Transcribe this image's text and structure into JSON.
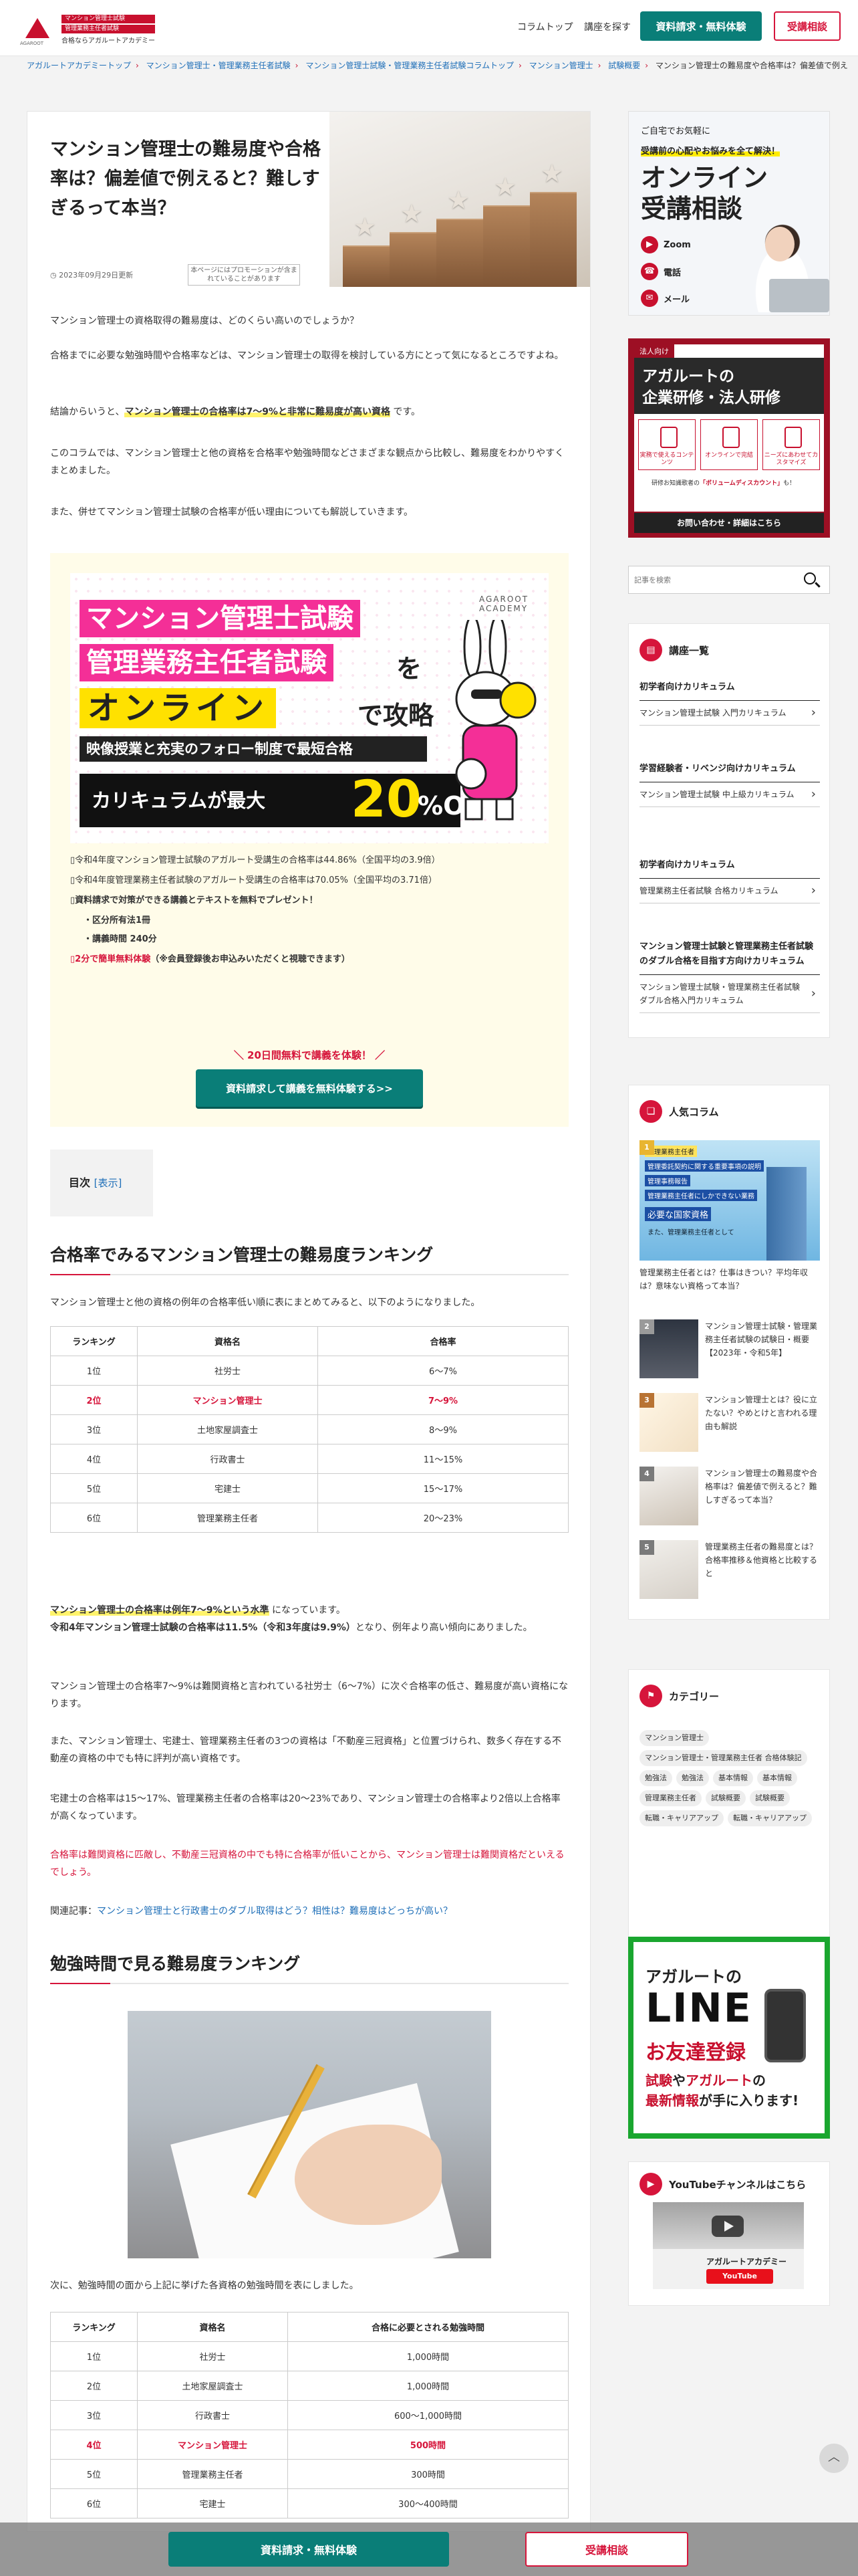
{
  "header": {
    "logo_mark": "AGAROOT",
    "logo_tag1": "マンション管理士試験",
    "logo_tag2": "管理業務主任者試験",
    "logo_sub": "合格ならアガルートアカデミー",
    "nav": [
      "コラムトップ",
      "講座を探す"
    ],
    "btn_request": "資料請求・無料体験",
    "btn_consult": "受講相談"
  },
  "breadcrumb": [
    "アガルートアカデミートップ",
    "マンション管理士・管理業務主任者試験",
    "マンション管理士試験・管理業務主任者試験コラムトップ",
    "マンション管理士",
    "試験概要",
    "マンション管理士の難易度や合格率は？偏差値で例える"
  ],
  "article": {
    "title": "マンション管理士の難易度や合格率は？偏差値で例えると？難しすぎるって本当？",
    "date": "2023年09月29日更新",
    "promo_note": "本ページにはプロモーションが含まれていることがあります",
    "p1": "マンション管理士の資格取得の難易度は、どのくらい高いのでしょうか？",
    "p2": "合格までに必要な勉強時間や合格率などは、マンション管理士の取得を検討している方にとって気になるところですよね。",
    "p3_pre": "結論からいうと、",
    "p3_hl": "マンション管理士の合格率は7〜9%と非常に難易度が高い資格",
    "p3_post": "です。",
    "p4": "このコラムでは、マンション管理士と他の資格を合格率や勉強時間などさまざまな観点から比較し、難易度をわかりやすくまとめました。",
    "p5": "また、併せてマンション管理士試験の合格率が低い理由についても解説していきます。",
    "toc_label": "目次",
    "toc_toggle": "[表示]",
    "h2_1": "合格率でみるマンション管理士の難易度ランキング",
    "p6": "マンション管理士と他の資格の例年の合格率低い順に表にまとめてみると、以下のようになりました。",
    "p7_hl": "マンション管理士の合格率は例年7〜9%という水準",
    "p7_post": "になっています。",
    "p7_b": "令和4年マンション管理士試験の合格率は11.5%（令和3年度は9.9%）",
    "p7_b_post": "となり、例年より高い傾向にありました。",
    "p8": "マンション管理士の合格率7〜9%は難関資格と言われている社労士（6〜7%）に次ぐ合格率の低さ、難易度が高い資格になります。",
    "p9": "また、マンション管理士、宅建士、管理業務主任者の3つの資格は「不動産三冠資格」と位置づけられ、数多く存在する不動産の資格の中でも特に評判が高い資格です。",
    "p10": "宅建士の合格率は15〜17%、管理業務主任者の合格率は20〜23%であり、マンション管理士の合格率より2倍以上合格率が高くなっています。",
    "p11": "合格率は難関資格に匹敵し、不動産三冠資格の中でも特に合格率が低いことから、マンション管理士は難関資格だといえるでしょう。",
    "related_pre": "関連記事：",
    "related_link": "マンション管理士と行政書士のダブル取得はどう？相性は？難易度はどっちが高い？",
    "h2_2": "勉強時間で見る難易度ランキング",
    "p12": "次に、勉強時間の面から上記に挙げた各資格の勉強時間を表にしました。"
  },
  "campaign": {
    "banner_logo": "AGAROOT ACADEMY",
    "banner_l1": "マンション管理士試験",
    "banner_l2": "管理業務主任者試験",
    "banner_l2w": "を",
    "banner_l3": "オンライン",
    "banner_l3w": "で攻略",
    "banner_l4": "映像授業と充実のフォロー制度で最短合格",
    "banner_l5": "カリキュラムが最大",
    "banner_l5n": "20",
    "banner_l5p": "%OFF",
    "li1": "▯令和4年度マンション管理士試験のアガルート受講生の合格率は44.86%（全国平均の3.9倍）",
    "li2": "▯令和4年度管理業務主任者試験のアガルート受講生の合格率は70.05%（全国平均の3.71倍）",
    "li3": "▯資料請求で対策ができる講義とテキストを無料でプレゼント！",
    "li3a": "・区分所有法1冊",
    "li3b": "・講義時間 240分",
    "li4_red": "▯2分で簡単無料体験",
    "li4_post": "（※会員登録後お申込みいただくと視聴できます）",
    "cta_text": "＼ 20日間無料で講義を体験！ ／",
    "cta_button": "資料請求して講義を無料体験する>>"
  },
  "table1": {
    "headers": [
      "ランキング",
      "資格名",
      "合格率"
    ],
    "rows": [
      [
        "1位",
        "社労士",
        "6〜7%"
      ],
      [
        "2位",
        "マンション管理士",
        "7〜9%"
      ],
      [
        "3位",
        "土地家屋調査士",
        "8〜9%"
      ],
      [
        "4位",
        "行政書士",
        "11〜15%"
      ],
      [
        "5位",
        "宅建士",
        "15〜17%"
      ],
      [
        "6位",
        "管理業務主任者",
        "20〜23%"
      ]
    ]
  },
  "table2": {
    "headers": [
      "ランキング",
      "資格名",
      "合格に必要とされる勉強時間"
    ],
    "rows": [
      [
        "1位",
        "社労士",
        "1,000時間"
      ],
      [
        "2位",
        "土地家屋調査士",
        "1,000時間"
      ],
      [
        "3位",
        "行政書士",
        "600〜1,000時間"
      ],
      [
        "4位",
        "マンション管理士",
        "500時間"
      ],
      [
        "5位",
        "管理業務主任者",
        "300時間"
      ],
      [
        "6位",
        "宅建士",
        "300〜400時間"
      ]
    ]
  },
  "sidebar": {
    "ad_online": {
      "t1": "ご自宅でお気軽に",
      "t2": "受講前の心配やお悩みを全て解決！",
      "t3a": "オンライン",
      "t3b": "受講相談",
      "i1": "Zoom",
      "i2": "電話",
      "i3": "メール"
    },
    "ad_corp": {
      "tag": "法人向け",
      "h1": "アガルートの",
      "h2": "企業研修・法人研修",
      "b1": "実務で使えるコンテンツ",
      "b2": "オンラインで完結",
      "b3": "ニーズにあわせてカスタマイズ",
      "note_pre": "研修お知識歌者の",
      "note_b": "「ボリュームディスカウント」",
      "note_post": "も！",
      "cta": "お問い合わせ・詳細はこちら"
    },
    "search_placeholder": "記事を検索",
    "courses": {
      "title": "講座一覧",
      "groups": [
        {
          "head": "初学者向けカリキュラム",
          "items": [
            "マンション管理士試験 入門カリキュラム"
          ]
        },
        {
          "head": "学習経験者・リベンジ向けカリキュラム",
          "items": [
            "マンション管理士試験 中上級カリキュラム"
          ]
        },
        {
          "head": "初学者向けカリキュラム",
          "items": [
            "管理業務主任者試験 合格カリキュラム"
          ]
        },
        {
          "head": "マンション管理士試験と管理業務主任者試験のダブル合格を目指す方向けカリキュラム",
          "items": [
            "マンション管理士試験・管理業務主任者試験 ダブル合格入門カリキュラム"
          ]
        }
      ]
    },
    "popular": {
      "title": "人気コラム",
      "feat_lines": [
        "管理業務主任者",
        "管理委託契約に関する重要事項の説明",
        "管理事務報告",
        "管理業務主任者にしかできない業務",
        "必要な国家資格"
      ],
      "feat_note": "また、管理業務主任者として",
      "items": [
        {
          "num": "1",
          "title": "管理業務主任者とは？仕事はきつい？平均年収は？意味ない資格って本当？"
        },
        {
          "num": "2",
          "title": "マンション管理士試験・管理業務主任者試験の試験日・概要【2023年・令和5年】"
        },
        {
          "num": "3",
          "title": "マンション管理士とは？役に立たない？やめとけと言われる理由も解説"
        },
        {
          "num": "4",
          "title": "マンション管理士の難易度や合格率は？偏差値で例えると？難しすぎるって本当？"
        },
        {
          "num": "5",
          "title": "管理業務主任者の難易度とは？合格率推移＆他資格と比較すると"
        }
      ]
    },
    "categories": {
      "title": "カテゴリー",
      "tags": [
        "マンション管理士",
        "マンション管理士・管理業務主任者 合格体験記",
        "勉強法",
        "勉強法",
        "基本情報",
        "基本情報",
        "管理業務主任者",
        "試験概要",
        "試験概要",
        "転職・キャリアアップ",
        "転職・キャリアアップ"
      ]
    },
    "ad_line": {
      "l1": "アガルートの",
      "l2": "LINE",
      "l3": "お友達登録",
      "l4a": "試験",
      "l4b": "や",
      "l4c": "アガルート",
      "l4d": "の",
      "l4e": "最新情報",
      "l4f": "が",
      "l4g": "手に入ります!"
    },
    "youtube": {
      "title": "YouTubeチャンネルはこちら",
      "channel": "アガルートアカデミー",
      "button": "YouTube"
    }
  },
  "footer_bar": {
    "request": "資料請求・無料体験",
    "consult": "受講相談"
  },
  "colors": {
    "brand": "#c8102e",
    "accent_green": "#0a7e78",
    "link": "#1f6fb8"
  }
}
